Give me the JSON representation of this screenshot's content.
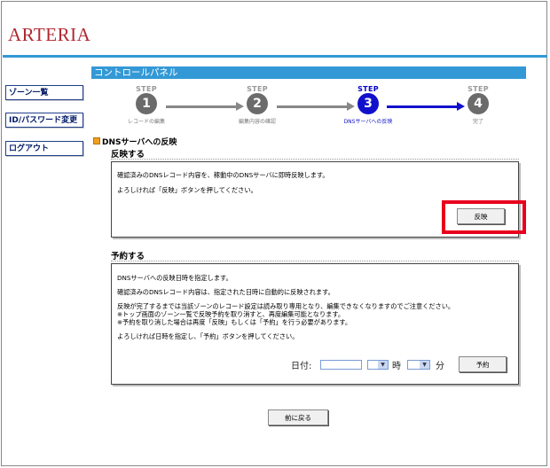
{
  "brand": {
    "logo_text": "ARTERIA"
  },
  "sidebar": {
    "items": [
      {
        "label": "ゾーン一覧"
      },
      {
        "label": "ID/パスワード変更"
      },
      {
        "label": "ログアウト"
      }
    ]
  },
  "panel_title": "コントロールパネル",
  "steps": [
    {
      "label": "STEP",
      "number": "1",
      "caption": "レコードの編集"
    },
    {
      "label": "STEP",
      "number": "2",
      "caption": "編集内容の確認"
    },
    {
      "label": "STEP",
      "number": "3",
      "caption": "DNSサーバへの反映"
    },
    {
      "label": "STEP",
      "number": "4",
      "caption": "完了"
    }
  ],
  "active_step": 3,
  "section_title": "DNSサーバへの反映",
  "reflect": {
    "heading": "反映する",
    "lines": [
      "確認済みのDNSレコード内容を、稼動中のDNSサーバに即時反映します。",
      "よろしければ「反映」ボタンを押してください。"
    ],
    "button_label": "反映"
  },
  "schedule": {
    "heading": "予約する",
    "lines": [
      "DNSサーバへの反映日時を指定します。",
      "確認済みのDNSレコード内容は、指定された日時に自動的に反映されます。",
      "反映が完了するまでは当該ゾーンのレコード設定は読み取り専用となり、編集できなくなりますのでご注意ください。",
      "※トップ画面のゾーン一覧で反映予約を取り消すと、再度編集可能となります。",
      "※予約を取り消した場合は再度「反映」もしくは「予約」を行う必要があります。",
      "よろしければ日時を指定し、「予約」ボタンを押してください。"
    ],
    "date_label": "日付:",
    "date_value": "",
    "hour_value": "",
    "hour_label": "時",
    "minute_value": "",
    "minute_label": "分",
    "button_label": "予約"
  },
  "back_button_label": "前に戻る",
  "colors": {
    "accent_blue": "#3399d6",
    "active_step": "#1111cc",
    "highlight_red": "#e8001c",
    "logo_red": "#b0282f"
  }
}
